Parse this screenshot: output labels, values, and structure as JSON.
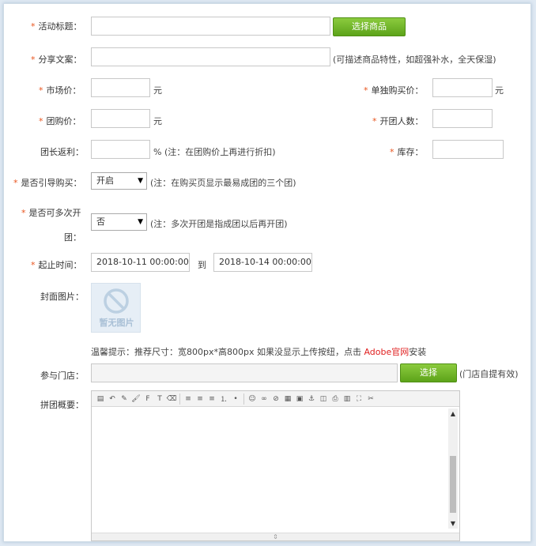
{
  "form": {
    "title": {
      "label": "活动标题：",
      "value": "",
      "button": "选择商品"
    },
    "share": {
      "label": "分享文案：",
      "value": "",
      "note": "(可描述商品特性，如超强补水，全天保湿)"
    },
    "market_price": {
      "label": "市场价：",
      "value": "",
      "unit": "元"
    },
    "single_price": {
      "label": "单独购买价：",
      "value": "",
      "unit": "元"
    },
    "group_price": {
      "label": "团购价：",
      "value": "",
      "unit": "元"
    },
    "group_size": {
      "label": "开团人数：",
      "value": ""
    },
    "leader_rebate": {
      "label": "团长返利：",
      "value": "",
      "note": "% (注：在团购价上再进行折扣)"
    },
    "stock": {
      "label": "库存：",
      "value": ""
    },
    "guide_buy": {
      "label": "是否引导购买：",
      "value": "开启",
      "note": "(注：在购买页显示最易成团的三个团)"
    },
    "multi_group": {
      "label_line1": "是否可多次开",
      "label_line2": "团：",
      "value": "否",
      "note": "(注：多次开团是指成团以后再开团)"
    },
    "time_range": {
      "label": "起止时间：",
      "start": "2018-10-11 00:00:00",
      "sep": "到",
      "end": "2018-10-14 00:00:00"
    },
    "cover": {
      "label": "封面图片：",
      "placeholder_text": "暂无图片"
    },
    "tip": {
      "prefix": "温馨提示：推荐尺寸：宽800px*高800px 如果没显示上传按纽，点击 ",
      "link": "Adobe官网",
      "suffix": "安装"
    },
    "store": {
      "label": "参与门店：",
      "value": "",
      "button": "选择",
      "note": "(门店自提有效)"
    },
    "summary": {
      "label": "拼团概要："
    }
  },
  "toolbar_icons": [
    "source-icon",
    "undo-icon",
    "paint-icon",
    "brush-icon",
    "font-family-icon",
    "font-size-icon",
    "eraser-icon",
    "|",
    "align-left-icon",
    "align-center-icon",
    "align-right-icon",
    "ordered-list-icon",
    "unordered-list-icon",
    "|",
    "emoticon-icon",
    "link-icon",
    "unlink-icon",
    "table-icon",
    "image-icon",
    "anchor-icon",
    "preview-icon",
    "print-icon",
    "template-icon",
    "fullscreen-icon",
    "cut-icon"
  ],
  "colors": {
    "accent_green": "#5da31a",
    "required_star": "#e8541e",
    "link_red": "#e02020"
  }
}
